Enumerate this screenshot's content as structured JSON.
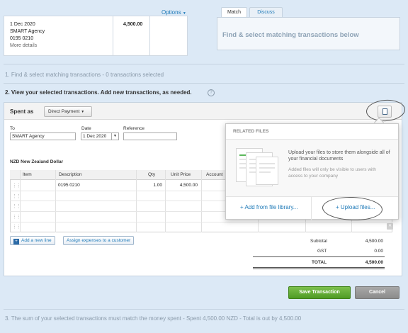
{
  "statement": {
    "date": "1 Dec 2020",
    "payee": "SMART Agency",
    "reference": "0195 0210",
    "more_details": "More details",
    "amount": "4,500.00"
  },
  "options_label": "Options",
  "tabs": {
    "match": "Match",
    "discuss": "Discuss"
  },
  "find_placeholder": "Find & select matching transactions below",
  "step1": "1. Find & select matching transactions - 0 transactions selected",
  "step2": "2. View your selected transactions. Add new transactions, as needed.",
  "help_glyph": "?",
  "spent_as": {
    "label": "Spent as",
    "payment_type": "Direct Payment"
  },
  "form": {
    "to_label": "To",
    "to_value": "SMART Agency",
    "date_label": "Date",
    "date_value": "1 Dec 2020",
    "reference_label": "Reference",
    "reference_value": ""
  },
  "currency": "NZD New Zealand Dollar",
  "table": {
    "headers": [
      "Item",
      "Description",
      "Qty",
      "Unit Price",
      "Account"
    ],
    "row1": {
      "item": "",
      "description": "0195 0210",
      "qty": "1.00",
      "unit_price": "4,500.00"
    }
  },
  "related_files": {
    "title": "RELATED FILES",
    "text": "Upload your files to store them alongside all of your financial documents",
    "subtext": "Added files will only be visible to users with access to your company",
    "from_library": "+ Add from file library...",
    "upload": "+ Upload files..."
  },
  "buttons": {
    "add_line": "Add a new line",
    "add_line_glyph": "+",
    "assign": "Assign expenses to a customer",
    "save": "Save Transaction",
    "cancel": "Cancel"
  },
  "totals": {
    "subtotal_label": "Subtotal",
    "subtotal": "4,500.00",
    "gst_label": "GST",
    "gst": "0.00",
    "total_label": "TOTAL",
    "total": "4,500.00"
  },
  "step3": "3. The sum of your selected transactions must match the money spent - Spent 4,500.00 NZD - Total is out by 4,500.00",
  "colors": {
    "link": "#1f7ab8",
    "save": "#5aa62e",
    "cancel": "#999999",
    "background": "#dce9f6"
  }
}
